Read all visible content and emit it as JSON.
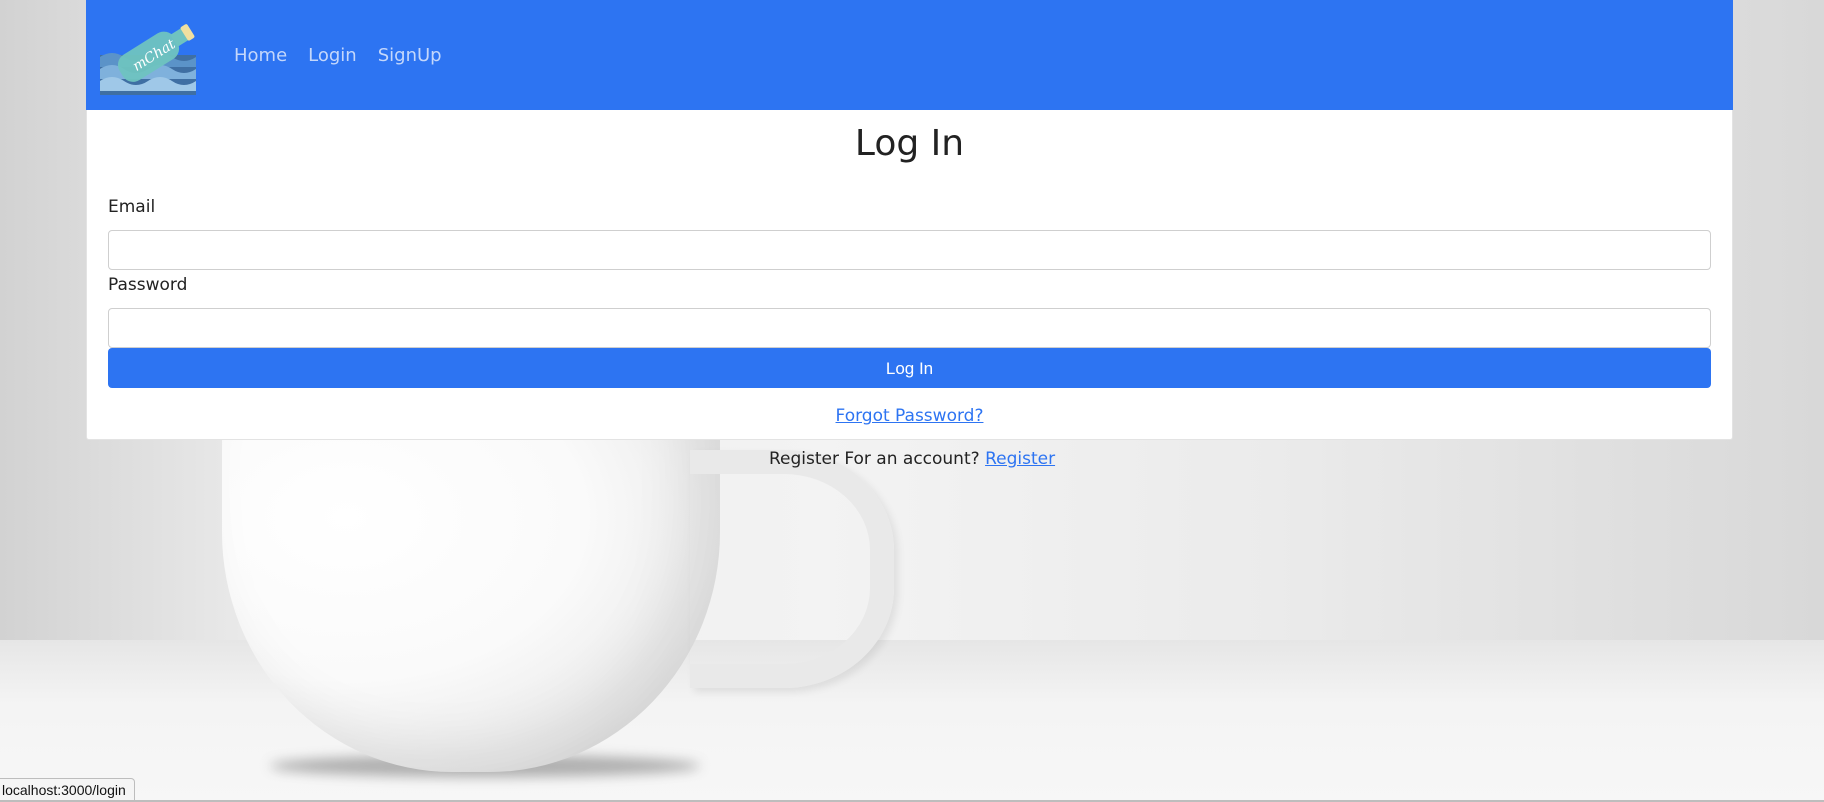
{
  "nav": {
    "logo_text": "mChat",
    "links": [
      {
        "label": "Home"
      },
      {
        "label": "Login"
      },
      {
        "label": "SignUp"
      }
    ]
  },
  "login_form": {
    "title": "Log In",
    "email_label": "Email",
    "email_value": "",
    "password_label": "Password",
    "password_value": "",
    "submit_label": "Log In",
    "forgot_label": "Forgot Password?"
  },
  "register": {
    "prompt": "Register For an account?",
    "link_label": "Register"
  },
  "status_bar": {
    "url": "localhost:3000/login"
  },
  "colors": {
    "primary": "#2d74f2",
    "nav_link": "#c4d7fb",
    "text": "#222222"
  }
}
